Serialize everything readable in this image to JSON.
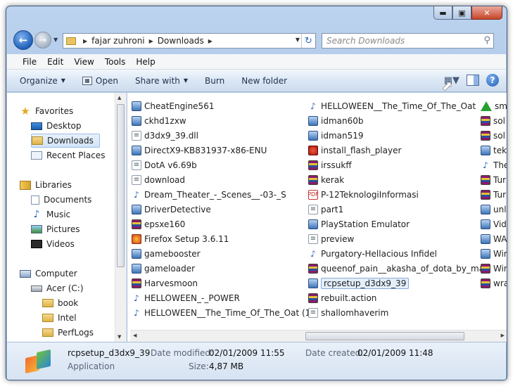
{
  "titlebar": {
    "min": "▬",
    "max": "▣",
    "close": "✕"
  },
  "address": {
    "crumbs": [
      "fajar zuhroni",
      "Downloads"
    ]
  },
  "search": {
    "placeholder": "Search Downloads"
  },
  "menu": [
    "File",
    "Edit",
    "View",
    "Tools",
    "Help"
  ],
  "toolbar": {
    "organize": "Organize",
    "open": "Open",
    "share": "Share with",
    "burn": "Burn",
    "new_folder": "New folder"
  },
  "nav": {
    "favorites": "Favorites",
    "desktop": "Desktop",
    "downloads": "Downloads",
    "recent": "Recent Places",
    "libraries": "Libraries",
    "documents": "Documents",
    "music": "Music",
    "pictures": "Pictures",
    "videos": "Videos",
    "computer": "Computer",
    "drive": "Acer (C:)",
    "book": "book",
    "intel": "Intel",
    "perflogs": "PerfLogs"
  },
  "files": {
    "col1": [
      {
        "name": "CheatEngine561",
        "icon": "app-icon"
      },
      {
        "name": "ckhd1zxw",
        "icon": "app-icon"
      },
      {
        "name": "d3dx9_39.dll",
        "icon": "file-icon"
      },
      {
        "name": "DirectX9-KB831937-x86-ENU",
        "icon": "app-icon"
      },
      {
        "name": "DotA v6.69b",
        "icon": "file-icon"
      },
      {
        "name": "download",
        "icon": "file-icon"
      },
      {
        "name": "Dream_Theater_-_Scenes__-03-_S",
        "icon": "music-icon"
      },
      {
        "name": "DriverDetective",
        "icon": "app-icon"
      },
      {
        "name": "epsxe160",
        "icon": "rar-icon"
      },
      {
        "name": "Firefox Setup 3.6.11",
        "icon": "firefox-icon"
      },
      {
        "name": "gamebooster",
        "icon": "app-icon"
      },
      {
        "name": "gameloader",
        "icon": "app-icon"
      },
      {
        "name": "Harvesmoon",
        "icon": "rar-icon"
      },
      {
        "name": "HELLOWEEN_-_POWER",
        "icon": "music-icon"
      },
      {
        "name": "HELLOWEEN__The_Time_Of_The_Oat (1)",
        "icon": "music-icon"
      }
    ],
    "col2": [
      {
        "name": "HELLOWEEN__The_Time_Of_The_Oat",
        "icon": "music-icon"
      },
      {
        "name": "idman60b",
        "icon": "app-icon"
      },
      {
        "name": "idman519",
        "icon": "app-icon"
      },
      {
        "name": "install_flash_player",
        "icon": "flash-icon"
      },
      {
        "name": "irssukff",
        "icon": "rar-icon"
      },
      {
        "name": "kerak",
        "icon": "rar-icon"
      },
      {
        "name": "P-12TeknologiInformasi",
        "icon": "pdf-icon"
      },
      {
        "name": "part1",
        "icon": "file-icon"
      },
      {
        "name": "PlayStation Emulator",
        "icon": "app-icon"
      },
      {
        "name": "preview",
        "icon": "file-icon"
      },
      {
        "name": "Purgatory-Hellacious Infidel",
        "icon": "music-icon"
      },
      {
        "name": "queenof_pain__akasha_of_dota_by_mar",
        "icon": "rar-icon"
      },
      {
        "name": "rcpsetup_d3dx9_39",
        "icon": "app-icon",
        "selected": true
      },
      {
        "name": "rebuilt.action",
        "icon": "rar-icon"
      },
      {
        "name": "shallomhaverim",
        "icon": "file-icon"
      }
    ],
    "col3": [
      {
        "name": "sm",
        "icon": "triangle-icon"
      },
      {
        "name": "sol",
        "icon": "rar-icon"
      },
      {
        "name": "sol",
        "icon": "rar-icon"
      },
      {
        "name": "tek",
        "icon": "app-icon"
      },
      {
        "name": "The",
        "icon": "music-icon"
      },
      {
        "name": "Tur",
        "icon": "rar-icon"
      },
      {
        "name": "Tur",
        "icon": "rar-icon"
      },
      {
        "name": "unl",
        "icon": "app-icon"
      },
      {
        "name": "Vid",
        "icon": "app-icon"
      },
      {
        "name": "WA",
        "icon": "app-icon"
      },
      {
        "name": "Wir",
        "icon": "app-icon"
      },
      {
        "name": "Wir",
        "icon": "rar-icon"
      },
      {
        "name": "wra",
        "icon": "rar-icon"
      }
    ]
  },
  "details": {
    "name": "rcpsetup_d3dx9_39",
    "type": "Application",
    "modified_label": "Date modified:",
    "modified": "02/01/2009 11:55",
    "created_label": "Date created:",
    "created": "02/01/2009 11:48",
    "size_label": "Size:",
    "size": "4,87 MB"
  }
}
